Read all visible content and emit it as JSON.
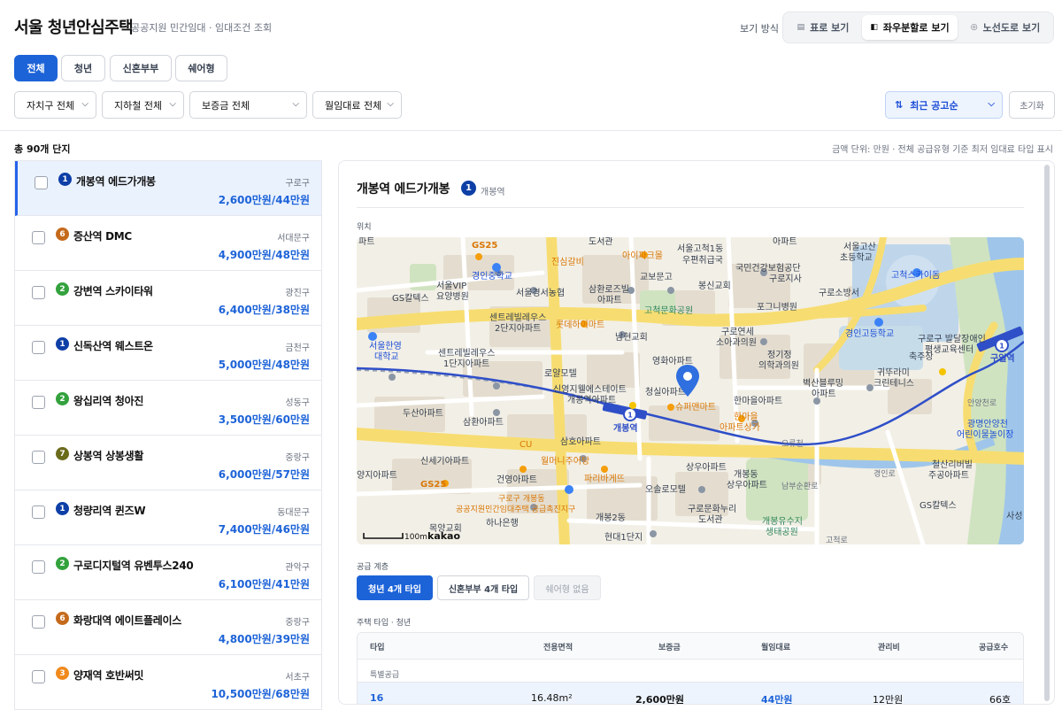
{
  "header": {
    "title": "서울 청년안심주택",
    "subtitle": "공공지원 민간임대 · 임대조건 조회",
    "view_label": "보기 방식",
    "view_modes": [
      {
        "label": "표로 보기",
        "icon": "table-icon"
      },
      {
        "label": "좌우분할로 보기",
        "icon": "split-view-icon"
      },
      {
        "label": "노선도로 보기",
        "icon": "route-map-icon"
      }
    ],
    "active_view": "좌우분할로 보기"
  },
  "tabs": [
    "전체",
    "청년",
    "신혼부부",
    "쉐어형"
  ],
  "active_tab": "전체",
  "filters": {
    "district": "자치구 전체",
    "subway": "지하철 전체",
    "deposit": "보증금 전체",
    "rent": "월임대료 전체",
    "sort": "최근 공고순",
    "reset": "초기화"
  },
  "summary": {
    "count": "총 90개 단지",
    "unit_note": "금액 단위: 만원 · 전체 공급유형 기준 최저 임대료 타입 표시"
  },
  "line_colors": {
    "1": "#0d3fa6",
    "2": "#33a23d",
    "3": "#f08a1d",
    "6": "#c56a1b",
    "7": "#6b6b1c"
  },
  "listings": [
    {
      "line": "1",
      "name": "개봉역 에드가개봉",
      "district": "구로구",
      "price": "2,600만원/44만원",
      "selected": true
    },
    {
      "line": "6",
      "name": "증산역 DMC",
      "district": "서대문구",
      "price": "4,900만원/48만원",
      "selected": false
    },
    {
      "line": "2",
      "name": "강변역 스카이타워",
      "district": "광진구",
      "price": "6,400만원/38만원",
      "selected": false
    },
    {
      "line": "1",
      "name": "신독산역 웨스트온",
      "district": "금천구",
      "price": "5,000만원/48만원",
      "selected": false
    },
    {
      "line": "2",
      "name": "왕십리역 청아진",
      "district": "성동구",
      "price": "3,500만원/60만원",
      "selected": false
    },
    {
      "line": "7",
      "name": "상봉역 상봉생활",
      "district": "중랑구",
      "price": "6,000만원/57만원",
      "selected": false
    },
    {
      "line": "1",
      "name": "청량리역 퀸즈W",
      "district": "동대문구",
      "price": "7,400만원/46만원",
      "selected": false
    },
    {
      "line": "2",
      "name": "구로디지털역 유벤투스240",
      "district": "관악구",
      "price": "6,100만원/41만원",
      "selected": false
    },
    {
      "line": "6",
      "name": "화랑대역 에이트플레이스",
      "district": "중랑구",
      "price": "4,800만원/39만원",
      "selected": false
    },
    {
      "line": "3",
      "name": "양재역 호반써밋",
      "district": "서초구",
      "price": "10,500만원/68만원",
      "selected": false
    }
  ],
  "detail": {
    "title": "개봉역 에드가개봉",
    "line": "1",
    "station": "개봉역",
    "location_label": "위치",
    "supply_label": "공급 계층",
    "supply_buttons": [
      "청년 4개 타입",
      "신혼부부 4개 타입",
      "쉐어형 없음"
    ],
    "housing_label": "주택 타입 · 청년",
    "table_headers": [
      "타입",
      "전용면적",
      "보증금",
      "월임대료",
      "관리비",
      "공급호수"
    ],
    "table_group": "특별공급",
    "table_rows": [
      [
        "16",
        "16.48m²",
        "2,600만원",
        "44만원",
        "12만원",
        "66호"
      ]
    ]
  },
  "map": {
    "scale": "100m",
    "brand": "kakao",
    "station_label": "개봉역",
    "labels": [
      "파트",
      "GS25",
      "도서관",
      "서울고척1동",
      "우편취급국",
      "아이파크몰",
      "아파트",
      "서울고산",
      "초등학교",
      "진심갈비",
      "교보문고",
      "국민건강보험공단",
      "구로지사",
      "봉신교회",
      "고척스카이돔",
      "서울VIP",
      "요양병원",
      "경인중학교",
      "서울경서농협",
      "삼환로즈빌",
      "아파트",
      "구로소방서",
      "GS칼텍스",
      "고척문화공원",
      "포그니병원",
      "센트레빌레우스",
      "2단지아파트",
      "롯데하이마트",
      "남현교회",
      "구로연세",
      "소아과의원",
      "경인고등학교",
      "구로구 발달장애인",
      "평생교육센터",
      "서울한영",
      "대학교",
      "센트레빌레우스",
      "1단지아파트",
      "로얄모텔",
      "영화아파트",
      "정기정",
      "의학과의원",
      "축주장",
      "귀뚜라미",
      "크린테니스",
      "벽산블루밍",
      "아파트",
      "신영지웰에스테이트",
      "개봉역아파트",
      "청실아파트",
      "한마을아파트",
      "두산아파트",
      "삼환아파트",
      "슈퍼맨마트",
      "한마을",
      "아파트상가",
      "구일역",
      "광명안양천",
      "어린이물놀이장",
      "CU",
      "삼호아파트",
      "신세기아파트",
      "월머니주어탕",
      "상우아파트",
      "개봉동",
      "상우아파트",
      "철산리버빌",
      "주공아파트",
      "양지아파트",
      "건영아파트",
      "파리바게뜨",
      "오솔로모텔",
      "남부순환로",
      "GS25",
      "구로구 개봉동",
      "공공지원민간임대주택 공급촉진지구",
      "개봉2동",
      "구로문화누리",
      "도서관",
      "GS칼텍스",
      "사성",
      "목양교회",
      "하나은행",
      "개봉유수지",
      "생태공원",
      "현대1단지",
      "오류천",
      "경인로",
      "고척로",
      "안양천로"
    ]
  }
}
